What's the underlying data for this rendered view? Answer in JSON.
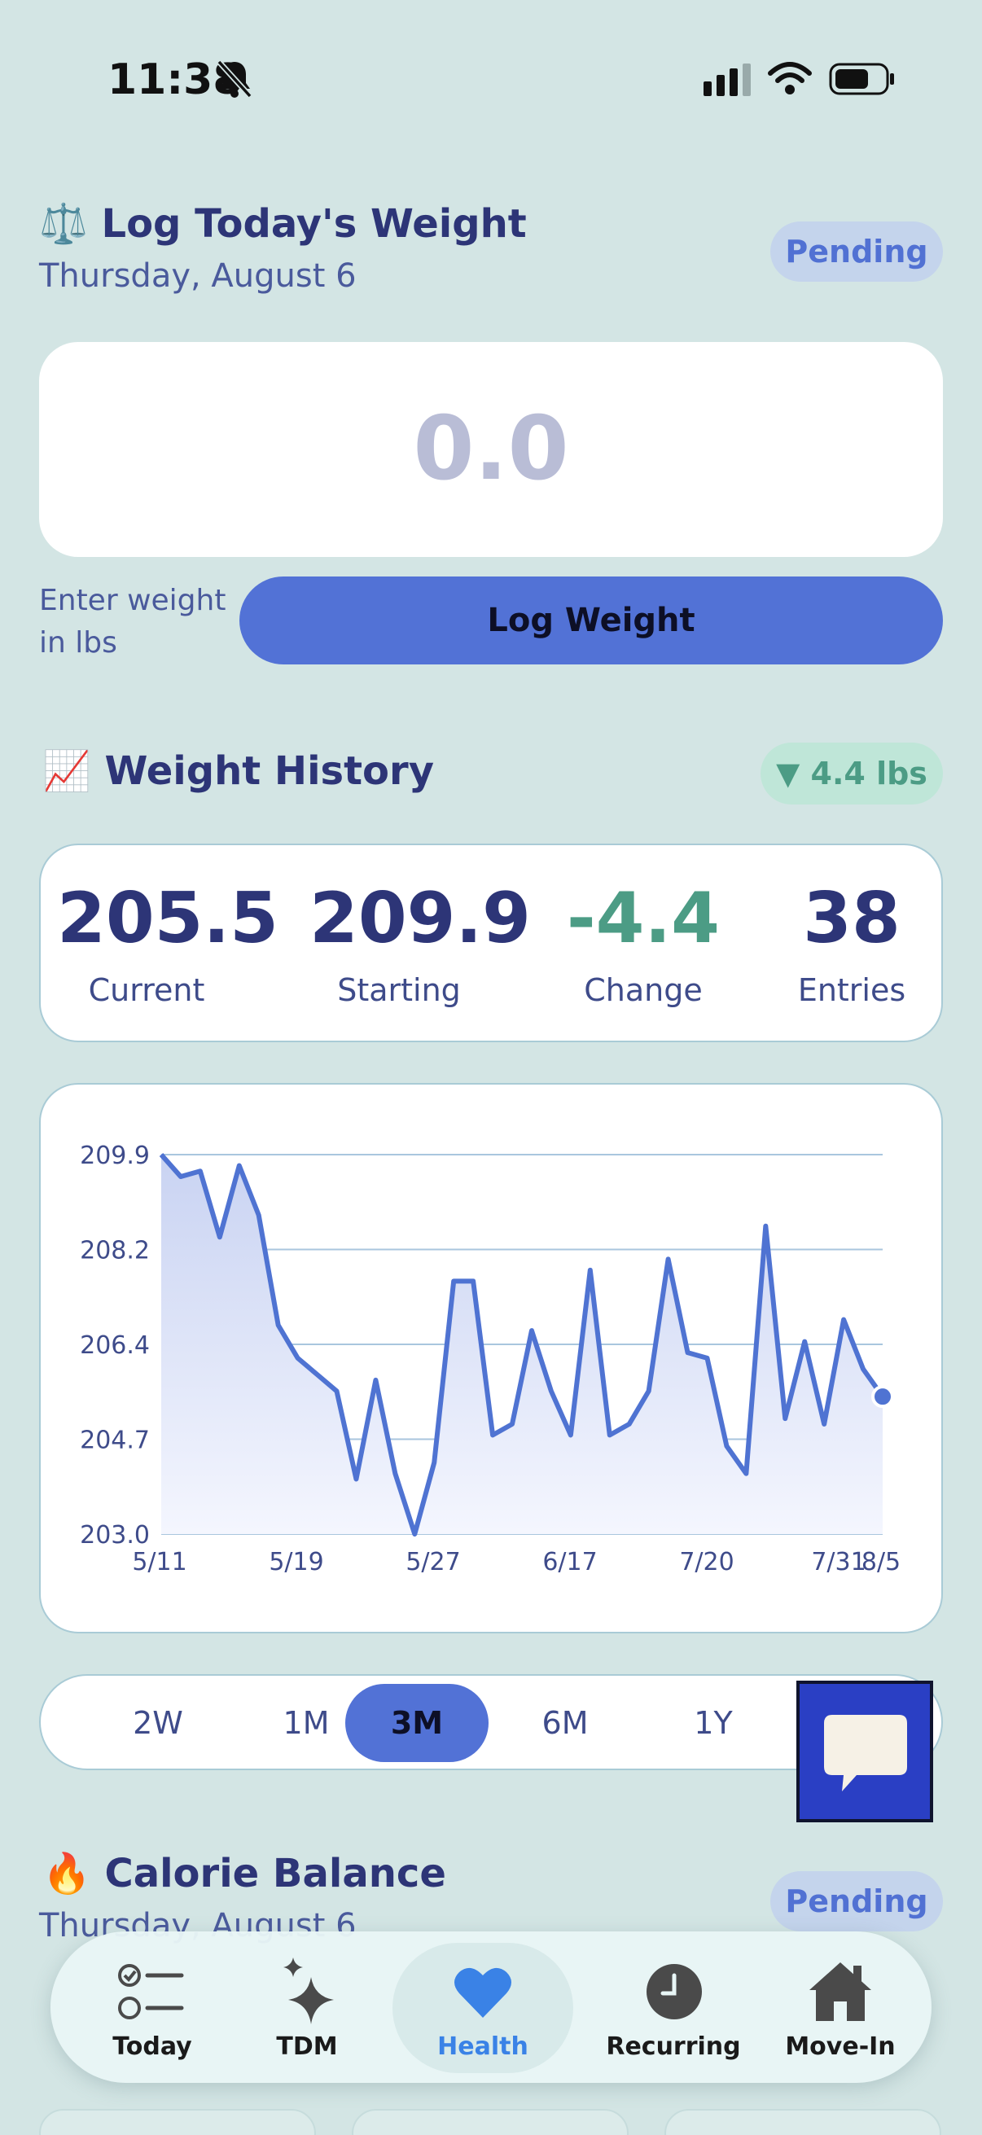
{
  "status_bar": {
    "time": "11:38"
  },
  "log_weight": {
    "emoji": "⚖️",
    "title": "Log Today's Weight",
    "date": "Thursday, August 6",
    "badge": "Pending",
    "input_placeholder": "0.0",
    "hint": "Enter weight in lbs",
    "button_label": "Log Weight"
  },
  "weight_history": {
    "emoji": "📈",
    "title": "Weight History",
    "delta_badge": "▼ 4.4 lbs",
    "stats": [
      {
        "value": "205.5",
        "label": "Current"
      },
      {
        "value": "209.9",
        "label": "Starting"
      },
      {
        "value": "-4.4",
        "label": "Change"
      },
      {
        "value": "38",
        "label": "Entries"
      }
    ]
  },
  "chart_data": {
    "type": "line",
    "y_ticks": [
      "209.9",
      "208.2",
      "206.4",
      "204.7",
      "203.0"
    ],
    "ylim": [
      203.0,
      209.9
    ],
    "x_tick_labels": [
      "5/11",
      "5/19",
      "5/27",
      "6/17",
      "7/20",
      "7/31",
      "8/5"
    ],
    "values": [
      209.9,
      209.5,
      209.6,
      208.4,
      209.7,
      208.8,
      206.8,
      206.2,
      205.9,
      205.6,
      204.0,
      205.8,
      204.1,
      203.0,
      204.3,
      207.6,
      207.6,
      204.8,
      205.0,
      206.7,
      205.6,
      204.8,
      207.8,
      204.8,
      205.0,
      205.6,
      208.0,
      206.3,
      206.2,
      204.6,
      204.1,
      208.6,
      205.1,
      206.5,
      205.0,
      206.9,
      206.0,
      205.5
    ],
    "color": "#4f73d2",
    "grid": true
  },
  "range_selector": {
    "options": [
      "2W",
      "1M",
      "3M",
      "6M",
      "1Y"
    ],
    "selected": "3M"
  },
  "calorie_balance": {
    "emoji": "🔥",
    "title": "Calorie Balance",
    "date": "Thursday, August 6",
    "badge": "Pending"
  },
  "tabbar": {
    "items": [
      {
        "label": "Today",
        "icon": "checklist-icon"
      },
      {
        "label": "TDM",
        "icon": "sparkles-icon"
      },
      {
        "label": "Health",
        "icon": "heart-icon"
      },
      {
        "label": "Recurring",
        "icon": "clock-icon"
      },
      {
        "label": "Move-In",
        "icon": "house-icon"
      }
    ],
    "active": "Health"
  },
  "colors": {
    "accent": "#5272d6",
    "background": "#d3e5e4",
    "positive": "#4c9c85",
    "title": "#2d3577"
  }
}
